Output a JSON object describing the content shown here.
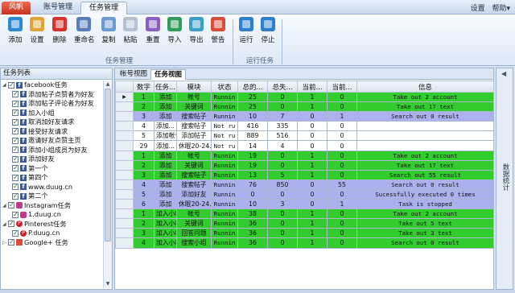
{
  "app_tabs": [
    "风帆",
    "账号管理",
    "任务管理"
  ],
  "top_right": {
    "settings": "设置",
    "help": "帮助▾"
  },
  "ribbon": {
    "buttons": [
      {
        "label": "添加",
        "icon": "add-icon",
        "color": "#2f8ad6"
      },
      {
        "label": "设置",
        "icon": "settings-icon",
        "color": "#e0a43a"
      },
      {
        "label": "删除",
        "icon": "delete-icon",
        "color": "#d8322a"
      },
      {
        "label": "重命名",
        "icon": "rename-icon",
        "color": "#5a7fb8"
      },
      {
        "label": "复制",
        "icon": "copy-icon",
        "color": "#6c9ad0"
      },
      {
        "label": "粘贴",
        "icon": "paste-icon",
        "color": "#b7c3d4"
      },
      {
        "label": "重置",
        "icon": "reset-icon",
        "color": "#8b5fbf"
      },
      {
        "label": "导入",
        "icon": "import-icon",
        "color": "#2f9e5a"
      },
      {
        "label": "导出",
        "icon": "export-icon",
        "color": "#3aa0c8"
      },
      {
        "label": "警告",
        "icon": "warning-icon",
        "color": "#d94c3a"
      },
      {
        "label": "运行",
        "icon": "run-icon",
        "color": "#2f7fd0"
      },
      {
        "label": "停止",
        "icon": "stop-icon",
        "color": "#2f7fd0"
      }
    ],
    "group_task": "任务管理",
    "group_run": "运行任务"
  },
  "left_panel": {
    "title": "任务列表",
    "items": [
      {
        "level": 0,
        "icon": "facebook-icon",
        "text": "facebook任务",
        "expand": "◢"
      },
      {
        "level": 1,
        "icon": "facebook-icon",
        "text": "添加帖子点赞者为好友"
      },
      {
        "level": 1,
        "icon": "facebook-icon",
        "text": "添加帖子评论者为好友"
      },
      {
        "level": 1,
        "icon": "facebook-icon",
        "text": "加入小组"
      },
      {
        "level": 1,
        "icon": "facebook-icon",
        "text": "取消加好友请求"
      },
      {
        "level": 1,
        "icon": "facebook-icon",
        "text": "接受好友请求"
      },
      {
        "level": 1,
        "icon": "facebook-icon",
        "text": "邀请好友点赞主页"
      },
      {
        "level": 1,
        "icon": "facebook-icon",
        "text": "添加小组成员为好友"
      },
      {
        "level": 1,
        "icon": "facebook-icon",
        "text": "添加好友"
      },
      {
        "level": 1,
        "icon": "facebook-icon",
        "text": "第一个"
      },
      {
        "level": 1,
        "icon": "facebook-icon",
        "text": "第四个"
      },
      {
        "level": 1,
        "icon": "facebook-icon",
        "text": "www.duug.cn"
      },
      {
        "level": 1,
        "icon": "facebook-icon",
        "text": "第二个"
      },
      {
        "level": 0,
        "icon": "instagram-icon",
        "text": "Instagram任务",
        "expand": "◢"
      },
      {
        "level": 1,
        "icon": "instagram-icon",
        "text": "1.duug.cn"
      },
      {
        "level": 0,
        "icon": "pinterest-icon",
        "text": "Pinterest任务",
        "expand": "◢"
      },
      {
        "level": 1,
        "icon": "pinterest-icon",
        "text": "P.duug.cn"
      },
      {
        "level": 0,
        "icon": "googleplus-icon",
        "text": "Google+ 任务",
        "expand": ""
      }
    ]
  },
  "main": {
    "tabs": [
      "帐号视图",
      "任务视图"
    ],
    "columns": [
      "数字",
      "任务...",
      "模块",
      "状态",
      "总的...",
      "总失...",
      "当前...",
      "当前...",
      "信息"
    ],
    "rows": [
      {
        "color": "green",
        "ind": "▶",
        "cells": [
          "1",
          "添加",
          "帐号",
          "Runnin",
          "25",
          "0",
          "1",
          "0",
          "Take out 2 account"
        ]
      },
      {
        "color": "green",
        "ind": "",
        "cells": [
          "2",
          "添加",
          "关键词",
          "Runnin",
          "25",
          "0",
          "1",
          "0",
          "Take out 17 text"
        ]
      },
      {
        "color": "blue",
        "ind": "",
        "cells": [
          "3",
          "添加",
          "搜索帖子",
          "Runnin",
          "10",
          "7",
          "0",
          "1",
          "Search out 0 result"
        ]
      },
      {
        "color": "white",
        "ind": "",
        "cells": [
          "4",
          "添加...",
          "搜索帖子",
          "Not ru",
          "416",
          "335",
          "0",
          "0",
          ""
        ]
      },
      {
        "color": "white",
        "ind": "",
        "cells": [
          "5",
          "添加帐号",
          "添加帖子",
          "Not ru",
          "889",
          "516",
          "0",
          "0",
          ""
        ]
      },
      {
        "color": "white",
        "ind": "",
        "cells": [
          "29",
          "添加...",
          "休眠20-24...",
          "Not ru",
          "14",
          "4",
          "0",
          "0",
          ""
        ]
      },
      {
        "color": "green",
        "ind": "",
        "cells": [
          "1",
          "添加",
          "帐号",
          "Runnin",
          "19",
          "0",
          "1",
          "0",
          "Take out 2 account"
        ]
      },
      {
        "color": "green",
        "ind": "",
        "cells": [
          "2",
          "添加",
          "关键词",
          "Runnin",
          "19",
          "0",
          "1",
          "0",
          "Take out 17 text"
        ]
      },
      {
        "color": "green",
        "ind": "",
        "cells": [
          "3",
          "添加",
          "搜索帖子",
          "Runnin",
          "13",
          "5",
          "1",
          "0",
          "Search out 55 result"
        ]
      },
      {
        "color": "blue",
        "ind": "",
        "cells": [
          "4",
          "添加",
          "搜索帖子",
          "Runnin",
          "76",
          "850",
          "0",
          "55",
          "Search out 0 result"
        ]
      },
      {
        "color": "blue",
        "ind": "",
        "cells": [
          "5",
          "添加",
          "添加好友",
          "Runnin",
          "0",
          "0",
          "0",
          "0",
          "Sucessfully executed 0 times"
        ]
      },
      {
        "color": "blue",
        "ind": "",
        "cells": [
          "6",
          "添加",
          "休眠20-24...",
          "Runnin",
          "10",
          "3",
          "0",
          "1",
          "Task is stopped"
        ]
      },
      {
        "color": "green",
        "ind": "",
        "cells": [
          "1",
          "加入小组",
          "帐号",
          "Runnin",
          "38",
          "0",
          "1",
          "0",
          "Take out 2 account"
        ]
      },
      {
        "color": "green",
        "ind": "",
        "cells": [
          "2",
          "加入小组",
          "关键词",
          "Runnin",
          "36",
          "0",
          "1",
          "0",
          "Take out 5 text"
        ]
      },
      {
        "color": "green",
        "ind": "",
        "cells": [
          "3",
          "加入小组",
          "回答问题",
          "Runnin",
          "36",
          "0",
          "1",
          "0",
          "Take out 3 text"
        ]
      },
      {
        "color": "green",
        "ind": "",
        "cells": [
          "4",
          "加入小组",
          "搜索小组",
          "Runnin",
          "36",
          "0",
          "1",
          "0",
          "Search out 0 result"
        ]
      }
    ]
  },
  "right_strip": {
    "label": "数据统计"
  },
  "colors": {
    "green": "#33cc2e",
    "blue": "#aab1ec",
    "accent": "#d8342a"
  }
}
